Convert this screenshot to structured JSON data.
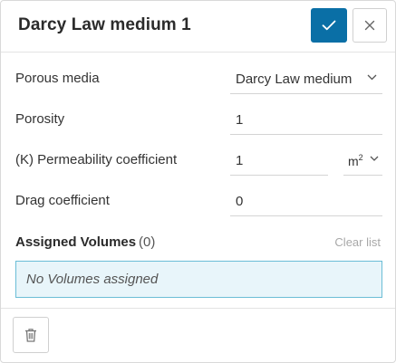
{
  "dialog": {
    "title": "Darcy Law medium 1",
    "confirm_icon": "check-icon",
    "close_icon": "close-icon"
  },
  "fields": {
    "porous_media": {
      "label": "Porous media",
      "value": "Darcy Law medium"
    },
    "porosity": {
      "label": "Porosity",
      "value": "1"
    },
    "permeability": {
      "label": "(K) Permeability coefficient",
      "value": "1",
      "unit_base": "m",
      "unit_exp": "2"
    },
    "drag": {
      "label": "Drag coefficient",
      "value": "0"
    }
  },
  "assigned": {
    "label": "Assigned Volumes",
    "count": "(0)",
    "clear_label": "Clear list",
    "empty_message": "No Volumes assigned"
  },
  "footer": {
    "delete_icon": "trash-icon"
  },
  "colors": {
    "accent": "#0a6fa6",
    "box_bg": "#e8f5fa",
    "box_border": "#6bbdd6"
  }
}
